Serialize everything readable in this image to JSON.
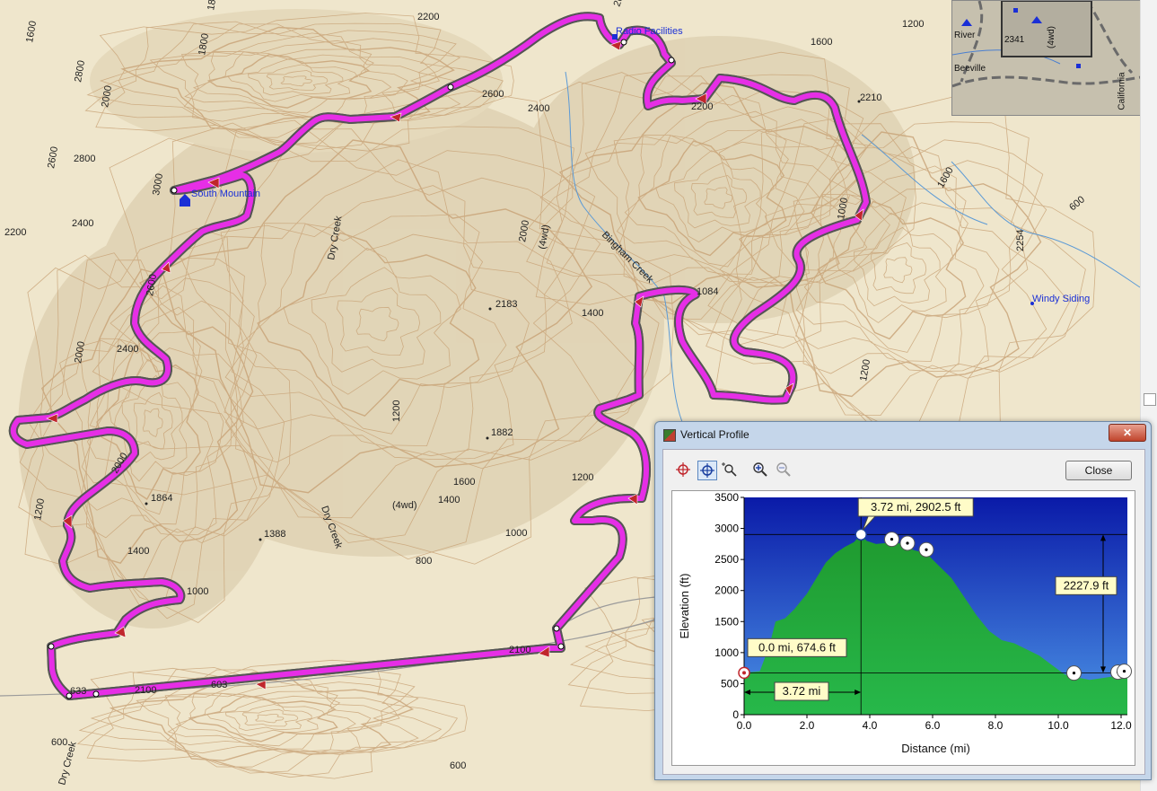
{
  "map": {
    "route_color": "#e62ee6",
    "contour_color": "#c8a276",
    "background": "#efe6cc",
    "elevation_labels": [
      "1800",
      "2200",
      "2600",
      "1600",
      "1800",
      "2000",
      "1200",
      "1600",
      "2800",
      "2600",
      "2400",
      "2200",
      "2210",
      "2600",
      "3000",
      "2800",
      "2400",
      "2200",
      "2000",
      "1600",
      "600",
      "2254",
      "2183",
      "1400",
      "1084",
      "2600",
      "2000",
      "1882",
      "1200",
      "1864",
      "1388",
      "1400",
      "1200",
      "1400",
      "1000",
      "800",
      "1600",
      "1400",
      "1200",
      "1000",
      "2000",
      "633",
      "2100",
      "603",
      "600",
      "600",
      "1200",
      "(4wd)",
      "(4wd)",
      "2400",
      "1000",
      "2100"
    ],
    "places": {
      "radio": "Radio Facilities",
      "south_mountain": "South Mountain",
      "windy_siding": "Windy Siding",
      "dry_creek_1": "Dry Creek",
      "dry_creek_2": "Dry Creek",
      "dry_creek_3": "Dry Creek",
      "bingham_creek": "Bingham Creek"
    }
  },
  "inset": {
    "labels": {
      "river": "River",
      "beeville": "Beeville",
      "california": "California",
      "road_num": "2341",
      "fourwd": "(4wd)"
    }
  },
  "profile_window": {
    "title": "Vertical Profile",
    "close_label": "Close",
    "close_x": "✕",
    "tools": [
      "pan-icon",
      "select-point-icon",
      "zoom-box-icon",
      "zoom-in-icon",
      "zoom-out-icon"
    ]
  },
  "chart_data": {
    "type": "area",
    "xlabel": "Distance   (mi)",
    "ylabel": "Elevation (ft)",
    "xlim": [
      0,
      12.2
    ],
    "ylim": [
      0,
      3500
    ],
    "x_ticks": [
      "0.0",
      "2.0",
      "4.0",
      "6.0",
      "8.0",
      "10.0",
      "12.0"
    ],
    "y_ticks": [
      "0",
      "500",
      "1000",
      "1500",
      "2000",
      "2500",
      "3000",
      "3500"
    ],
    "series": [
      {
        "x": [
          0,
          0.5,
          0.8,
          1.0,
          1.3,
          1.6,
          2.0,
          2.3,
          2.6,
          2.9,
          3.2,
          3.5,
          3.72,
          3.9,
          4.2,
          4.6,
          5.0,
          5.4,
          5.8,
          6.2,
          6.6,
          7.0,
          7.4,
          7.8,
          8.2,
          8.6,
          9.0,
          9.4,
          9.8,
          10.2,
          10.6,
          11.0,
          11.4,
          11.8,
          12.2
        ],
        "y": [
          674.6,
          700,
          1100,
          1500,
          1550,
          1700,
          1950,
          2200,
          2450,
          2600,
          2700,
          2780,
          2902.5,
          2800,
          2750,
          2770,
          2760,
          2650,
          2600,
          2400,
          2200,
          1900,
          1600,
          1350,
          1200,
          1150,
          1050,
          950,
          800,
          650,
          600,
          560,
          590,
          620,
          650
        ]
      }
    ],
    "annotations": {
      "start": "0.0 mi, 674.6 ft",
      "peak": "3.72 mi, 2902.5 ft",
      "delta_elev": "2227.9 ft",
      "delta_dist": "3.72 mi"
    },
    "markers_x": [
      0,
      3.72,
      4.7,
      5.2,
      5.8,
      10.5,
      11.9,
      12.1
    ],
    "grid": false,
    "colors": {
      "sky_top": "#0a1aa8",
      "sky_bottom": "#4b93e6",
      "ground_top": "#1f9a2f",
      "ground_bottom": "#27b84a"
    }
  }
}
